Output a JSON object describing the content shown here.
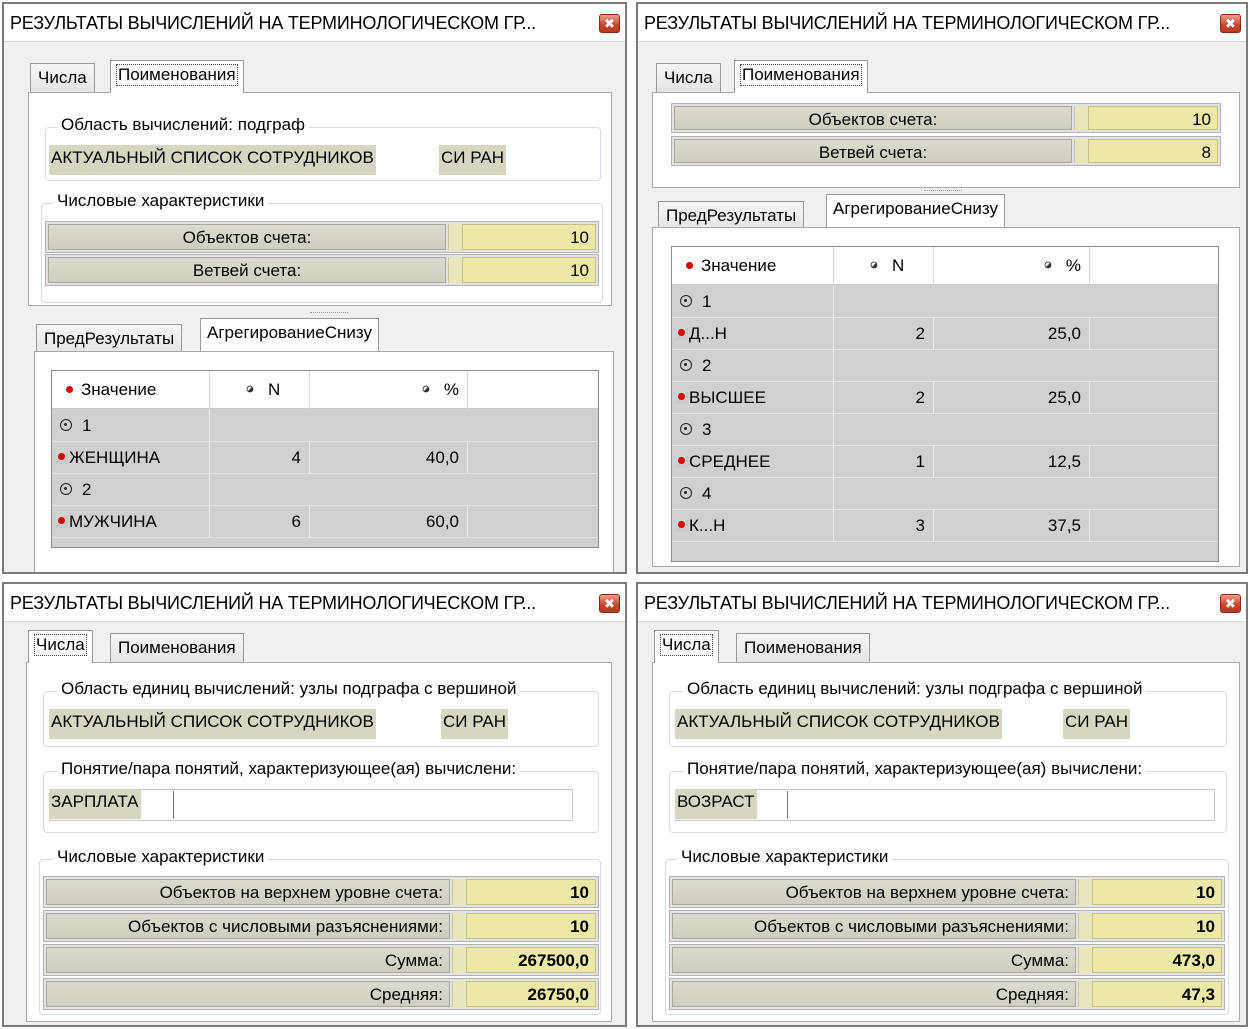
{
  "title": "РЕЗУЛЬТАТЫ ВЫЧИСЛЕНИЙ НА ТЕРМИНОЛОГИЧЕСКОМ ГР...",
  "close_glyph": "✖",
  "tabs": {
    "numbers": "Числа",
    "names": "Поименования"
  },
  "subtabs": {
    "pre": "ПредРезультаты",
    "agg": "АгрегированиеСнизу"
  },
  "grid_headers": {
    "value": "Значение",
    "n": "N",
    "pct": "%"
  },
  "win_tl": {
    "area_legend": "Область вычислений: подграф",
    "area_name": "АКТУАЛЬНЫЙ СПИСОК СОТРУДНИКОВ",
    "area_org": "СИ РАН",
    "stats_legend": "Числовые характеристики",
    "stats": [
      {
        "label": "Объектов счета:",
        "value": "10"
      },
      {
        "label": "Ветвей счета:",
        "value": "10"
      }
    ],
    "rows": [
      {
        "kind": "group",
        "text": "1"
      },
      {
        "kind": "item",
        "text": "ЖЕНЩИНА",
        "n": "4",
        "pct": "40,0"
      },
      {
        "kind": "group",
        "text": "2"
      },
      {
        "kind": "item",
        "text": "МУЖЧИНА",
        "n": "6",
        "pct": "60,0"
      }
    ]
  },
  "win_tr": {
    "stats": [
      {
        "label": "Объектов счета:",
        "value": "10"
      },
      {
        "label": "Ветвей счета:",
        "value": "8"
      }
    ],
    "rows": [
      {
        "kind": "group",
        "text": "1"
      },
      {
        "kind": "item",
        "text": "Д...Н",
        "n": "2",
        "pct": "25,0"
      },
      {
        "kind": "group",
        "text": "2"
      },
      {
        "kind": "item",
        "text": "ВЫСШЕЕ",
        "n": "2",
        "pct": "25,0"
      },
      {
        "kind": "group",
        "text": "3"
      },
      {
        "kind": "item",
        "text": "СРЕДНЕЕ",
        "n": "1",
        "pct": "12,5"
      },
      {
        "kind": "group",
        "text": "4"
      },
      {
        "kind": "item",
        "text": "К...Н",
        "n": "3",
        "pct": "37,5"
      }
    ]
  },
  "win_bl": {
    "area_legend": "Область единиц вычислений: узлы подграфа с вершиной",
    "area_name": "АКТУАЛЬНЫЙ СПИСОК СОТРУДНИКОВ",
    "area_org": "СИ РАН",
    "concept_legend": "Понятие/пара понятий, характеризующее(ая) вычислени:",
    "concept_value": "ЗАРПЛАТА",
    "stats_legend": "Числовые характеристики",
    "stats": [
      {
        "label": "Объектов на верхнем уровне счета:",
        "value": "10"
      },
      {
        "label": "Объектов с числовыми разъяснениями:",
        "value": "10"
      },
      {
        "label": "Сумма:",
        "value": "267500,0"
      },
      {
        "label": "Средняя:",
        "value": "26750,0"
      }
    ]
  },
  "win_br": {
    "area_legend": "Область единиц вычислений: узлы подграфа с вершиной",
    "area_name": "АКТУАЛЬНЫЙ СПИСОК СОТРУДНИКОВ",
    "area_org": "СИ РАН",
    "concept_legend": "Понятие/пара понятий, характеризующее(ая) вычислени:",
    "concept_value": "ВОЗРАСТ",
    "stats_legend": "Числовые характеристики",
    "stats": [
      {
        "label": "Объектов на верхнем уровне счета:",
        "value": "10"
      },
      {
        "label": "Объектов с числовыми разъяснениями:",
        "value": "10"
      },
      {
        "label": "Сумма:",
        "value": "473,0"
      },
      {
        "label": "Средняя:",
        "value": "47,3"
      }
    ]
  }
}
